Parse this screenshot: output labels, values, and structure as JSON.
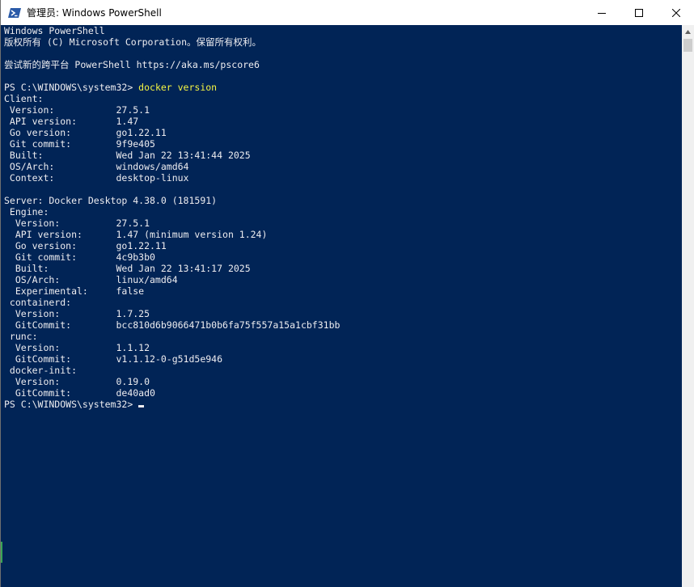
{
  "window": {
    "title": "管理员: Windows PowerShell",
    "app_icon": "powershell-icon",
    "caption_buttons": [
      "minimize-icon",
      "maximize-icon",
      "close-icon"
    ],
    "background_color": "#012456",
    "text_color": "#eeedf0",
    "command_color": "#f5f543"
  },
  "console": {
    "lines": [
      {
        "text": "Windows PowerShell"
      },
      {
        "text": "版权所有 (C) Microsoft Corporation。保留所有权利。"
      },
      {
        "text": ""
      },
      {
        "text": "尝试新的跨平台 PowerShell https://aka.ms/pscore6"
      },
      {
        "text": ""
      },
      {
        "prompt": "PS C:\\WINDOWS\\system32> ",
        "command": "docker version"
      },
      {
        "text": "Client:"
      },
      {
        "text": " Version:           27.5.1"
      },
      {
        "text": " API version:       1.47"
      },
      {
        "text": " Go version:        go1.22.11"
      },
      {
        "text": " Git commit:        9f9e405"
      },
      {
        "text": " Built:             Wed Jan 22 13:41:44 2025"
      },
      {
        "text": " OS/Arch:           windows/amd64"
      },
      {
        "text": " Context:           desktop-linux"
      },
      {
        "text": ""
      },
      {
        "text": "Server: Docker Desktop 4.38.0 (181591)"
      },
      {
        "text": " Engine:"
      },
      {
        "text": "  Version:          27.5.1"
      },
      {
        "text": "  API version:      1.47 (minimum version 1.24)"
      },
      {
        "text": "  Go version:       go1.22.11"
      },
      {
        "text": "  Git commit:       4c9b3b0"
      },
      {
        "text": "  Built:            Wed Jan 22 13:41:17 2025"
      },
      {
        "text": "  OS/Arch:          linux/amd64"
      },
      {
        "text": "  Experimental:     false"
      },
      {
        "text": " containerd:"
      },
      {
        "text": "  Version:          1.7.25"
      },
      {
        "text": "  GitCommit:        bcc810d6b9066471b0b6fa75f557a15a1cbf31bb"
      },
      {
        "text": " runc:"
      },
      {
        "text": "  Version:          1.1.12"
      },
      {
        "text": "  GitCommit:        v1.1.12-0-g51d5e946"
      },
      {
        "text": " docker-init:"
      },
      {
        "text": "  Version:          0.19.0"
      },
      {
        "text": "  GitCommit:        de40ad0"
      },
      {
        "prompt": "PS C:\\WINDOWS\\system32> ",
        "command": "",
        "cursor": true
      }
    ]
  }
}
